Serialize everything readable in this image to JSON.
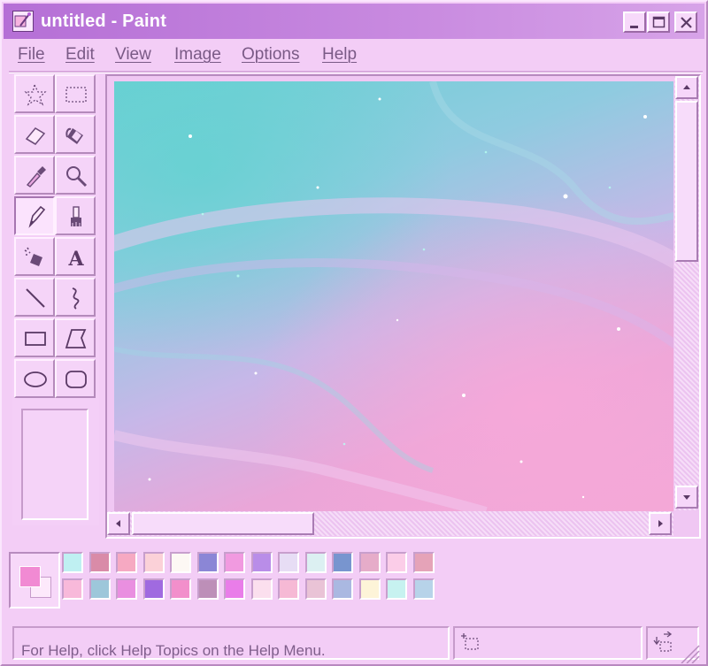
{
  "window": {
    "title": "untitled - Paint"
  },
  "menubar": {
    "items": [
      {
        "label": "File"
      },
      {
        "label": "Edit"
      },
      {
        "label": "View"
      },
      {
        "label": "Image"
      },
      {
        "label": "Options"
      },
      {
        "label": "Help"
      }
    ]
  },
  "toolbox": {
    "tools": [
      {
        "icon": "free-form-select-icon"
      },
      {
        "icon": "rect-select-icon"
      },
      {
        "icon": "eraser-icon"
      },
      {
        "icon": "fill-bucket-icon"
      },
      {
        "icon": "color-picker-icon"
      },
      {
        "icon": "magnifier-icon"
      },
      {
        "icon": "pencil-icon",
        "active": true
      },
      {
        "icon": "brush-icon"
      },
      {
        "icon": "airbrush-icon"
      },
      {
        "icon": "text-icon",
        "glyph": "A"
      },
      {
        "icon": "line-icon"
      },
      {
        "icon": "curve-icon"
      },
      {
        "icon": "rectangle-icon"
      },
      {
        "icon": "polygon-icon"
      },
      {
        "icon": "ellipse-icon"
      },
      {
        "icon": "rounded-rect-icon"
      }
    ]
  },
  "colors": {
    "foreground": "#f18ad3",
    "background": "#fde9fb",
    "palette_top": [
      "#bff0f2",
      "#d98ba8",
      "#f6a9c2",
      "#fbd1d8",
      "#fdf8f4",
      "#8b86d6",
      "#f19ae0",
      "#b98de8",
      "#e7ddf5",
      "#dcf0f2",
      "#7895cf",
      "#e6acc9",
      "#fbcde8",
      "#e5a3b8"
    ],
    "palette_bottom": [
      "#f8b9da",
      "#9dc7da",
      "#e98fe0",
      "#a06ae0",
      "#f28fcb",
      "#bd8fb8",
      "#e97de9",
      "#fbdfee",
      "#f6b9d5",
      "#e9c3d6",
      "#aab8e1",
      "#fdf4d8",
      "#c7f2f0",
      "#b7d3e9"
    ]
  },
  "statusbar": {
    "help_text": "For Help, click Help Topics on the Help Menu."
  }
}
